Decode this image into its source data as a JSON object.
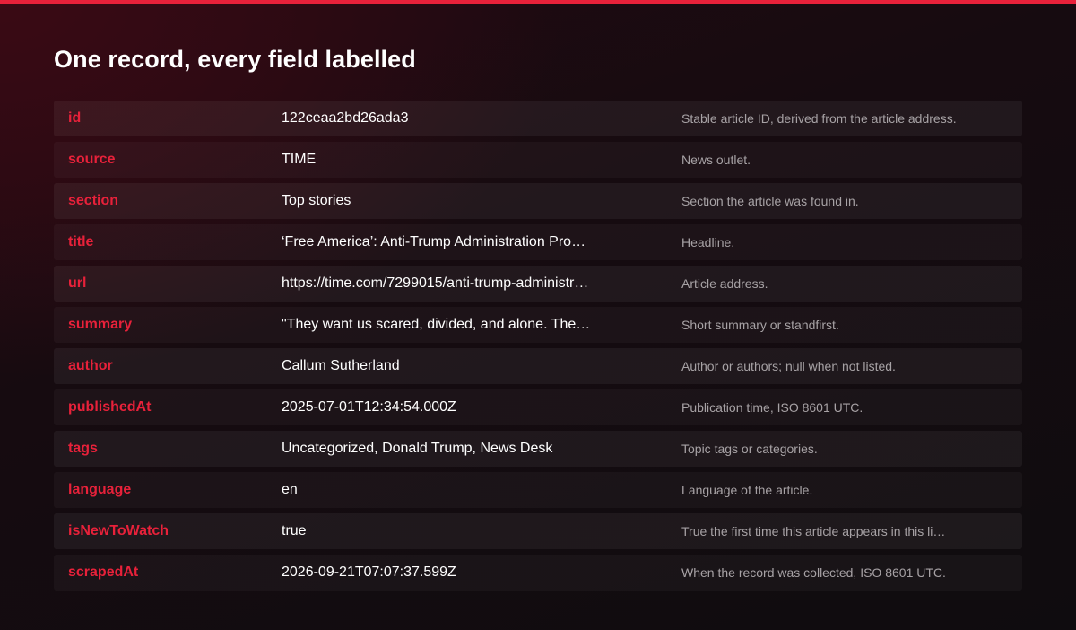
{
  "title": "One record, every field labelled",
  "accent_color": "#e8213a",
  "fields": [
    {
      "name": "id",
      "value": "122ceaa2bd26ada3",
      "description": "Stable article ID, derived from the article address."
    },
    {
      "name": "source",
      "value": "TIME",
      "description": "News outlet."
    },
    {
      "name": "section",
      "value": "Top stories",
      "description": "Section the article was found in."
    },
    {
      "name": "title",
      "value": "‘Free America’: Anti-Trump Administration Pro…",
      "description": "Headline."
    },
    {
      "name": "url",
      "value": "https://time.com/7299015/anti-trump-administr…",
      "description": "Article address."
    },
    {
      "name": "summary",
      "value": "\"They want us scared, divided, and alone. The…",
      "description": "Short summary or standfirst."
    },
    {
      "name": "author",
      "value": "Callum Sutherland",
      "description": "Author or authors; null when not listed."
    },
    {
      "name": "publishedAt",
      "value": "2025-07-01T12:34:54.000Z",
      "description": "Publication time, ISO 8601 UTC."
    },
    {
      "name": "tags",
      "value": "Uncategorized, Donald Trump, News Desk",
      "description": "Topic tags or categories."
    },
    {
      "name": "language",
      "value": "en",
      "description": "Language of the article."
    },
    {
      "name": "isNewToWatch",
      "value": "true",
      "description": "True the first time this article appears in this li…"
    },
    {
      "name": "scrapedAt",
      "value": "2026-09-21T07:07:37.599Z",
      "description": "When the record was collected, ISO 8601 UTC."
    }
  ]
}
